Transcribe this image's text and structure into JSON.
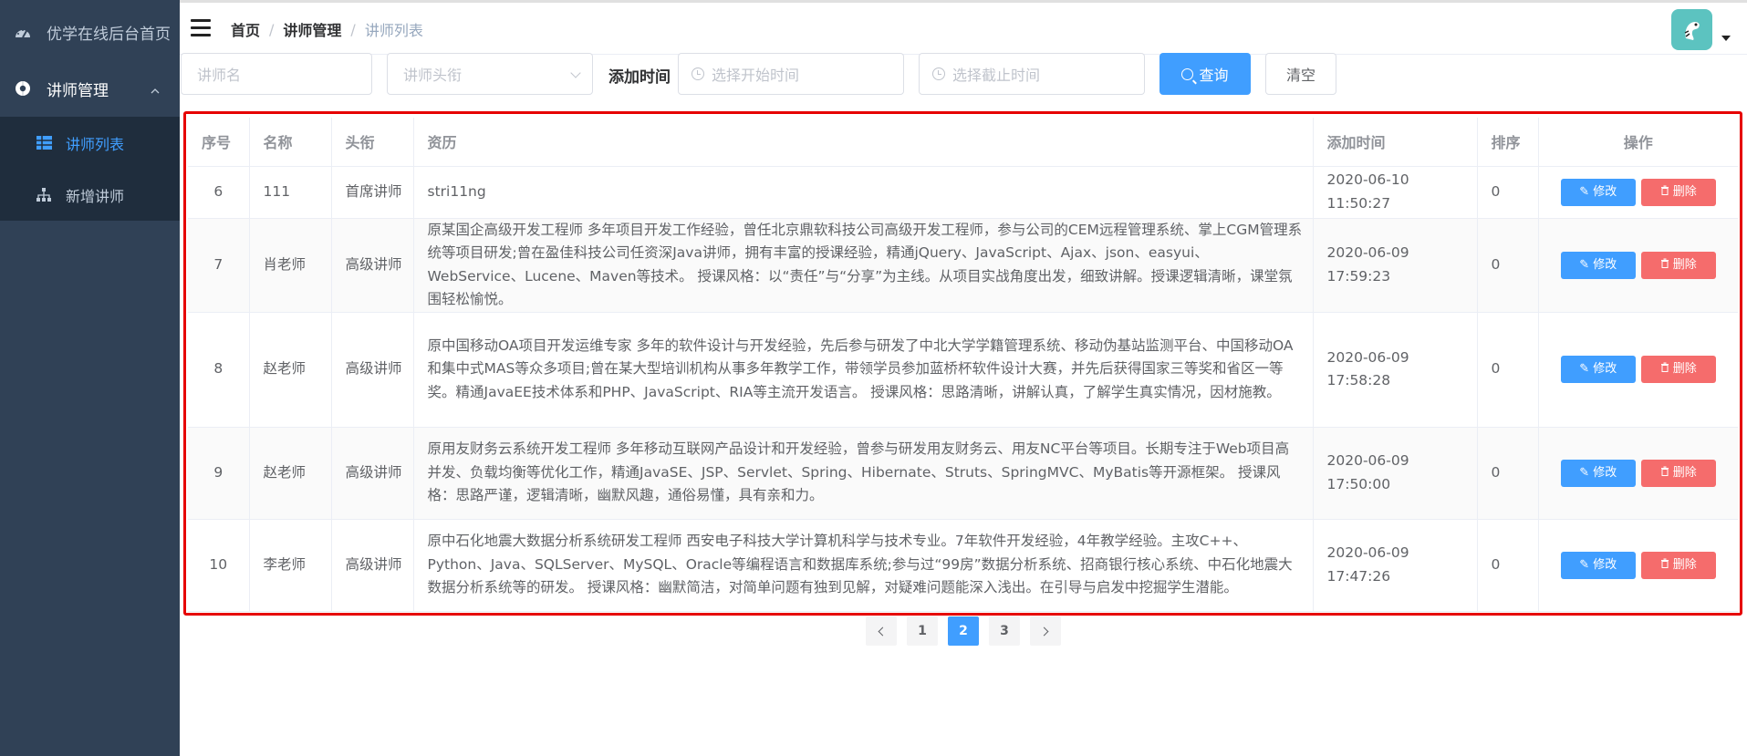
{
  "sidebar": {
    "home": "优学在线后台首页",
    "group": "讲师管理",
    "items": [
      {
        "label": "讲师列表",
        "active": true
      },
      {
        "label": "新增讲师",
        "active": false
      }
    ]
  },
  "navbar": {
    "breadcrumb": [
      "首页",
      "讲师管理",
      "讲师列表"
    ],
    "separator": "/"
  },
  "search": {
    "name_placeholder": "讲师名",
    "level_placeholder": "讲师头衔",
    "time_label": "添加时间",
    "start_placeholder": "选择开始时间",
    "end_placeholder": "选择截止时间",
    "query_label": "查询",
    "clear_label": "清空"
  },
  "table": {
    "headers": [
      "序号",
      "名称",
      "头衔",
      "资历",
      "添加时间",
      "排序",
      "操作"
    ],
    "edit_label": "修改",
    "delete_label": "删除",
    "rows": [
      {
        "index": "6",
        "name": "111",
        "level": "首席讲师",
        "intro": "stri11ng",
        "time": "2020-06-10 11:50:27",
        "sort": "0"
      },
      {
        "index": "7",
        "name": "肖老师",
        "level": "高级讲师",
        "intro": "原某国企高级开发工程师 多年项目开发工作经验，曾任北京鼎软科技公司高级开发工程师，参与公司的CEM远程管理系统、掌上CGM管理系统等项目研发;曾在盈佳科技公司任资深Java讲师，拥有丰富的授课经验，精通jQuery、JavaScript、Ajax、json、easyui、WebService、Lucene、Maven等技术。 授课风格：以“责任”与“分享”为主线。从项目实战角度出发，细致讲解。授课逻辑清晰，课堂氛围轻松愉悦。",
        "time": "2020-06-09 17:59:23",
        "sort": "0"
      },
      {
        "index": "8",
        "name": "赵老师",
        "level": "高级讲师",
        "intro": "原中国移动OA项目开发运维专家 多年的软件设计与开发经验，先后参与研发了中北大学学籍管理系统、移动伪基站监测平台、中国移动OA和集中式MAS等众多项目;曾在某大型培训机构从事多年教学工作，带领学员参加蓝桥杯软件设计大赛，并先后获得国家三等奖和省区一等奖。精通JavaEE技术体系和PHP、JavaScript、RIA等主流开发语言。 授课风格：思路清晰，讲解认真，了解学生真实情况，因材施教。",
        "time": "2020-06-09 17:58:28",
        "sort": "0"
      },
      {
        "index": "9",
        "name": "赵老师",
        "level": "高级讲师",
        "intro": "原用友财务云系统开发工程师 多年移动互联网产品设计和开发经验，曾参与研发用友财务云、用友NC平台等项目。长期专注于Web项目高并发、负载均衡等优化工作，精通JavaSE、JSP、Servlet、Spring、Hibernate、Struts、SpringMVC、MyBatis等开源框架。 授课风格：思路严谨，逻辑清晰，幽默风趣，通俗易懂，具有亲和力。",
        "time": "2020-06-09 17:50:00",
        "sort": "0"
      },
      {
        "index": "10",
        "name": "李老师",
        "level": "高级讲师",
        "intro": "原中石化地震大数据分析系统研发工程师 西安电子科技大学计算机科学与技术专业。7年软件开发经验，4年教学经验。主攻C++、Python、Java、SQLServer、MySQL、Oracle等编程语言和数据库系统;参与过“99房”数据分析系统、招商银行核心系统、中石化地震大数据分析系统等的研发。 授课风格：幽默简洁，对简单问题有独到见解，对疑难问题能深入浅出。在引导与启发中挖掘学生潜能。",
        "time": "2020-06-09 17:47:26",
        "sort": "0"
      }
    ]
  },
  "pagination": {
    "pages": [
      "1",
      "2",
      "3"
    ],
    "current": "2"
  },
  "colors": {
    "sidebar_bg": "#304156",
    "submenu_bg": "#1f2d3d",
    "primary": "#409eff",
    "danger": "#f56c6c",
    "highlight_border": "#e60000"
  }
}
